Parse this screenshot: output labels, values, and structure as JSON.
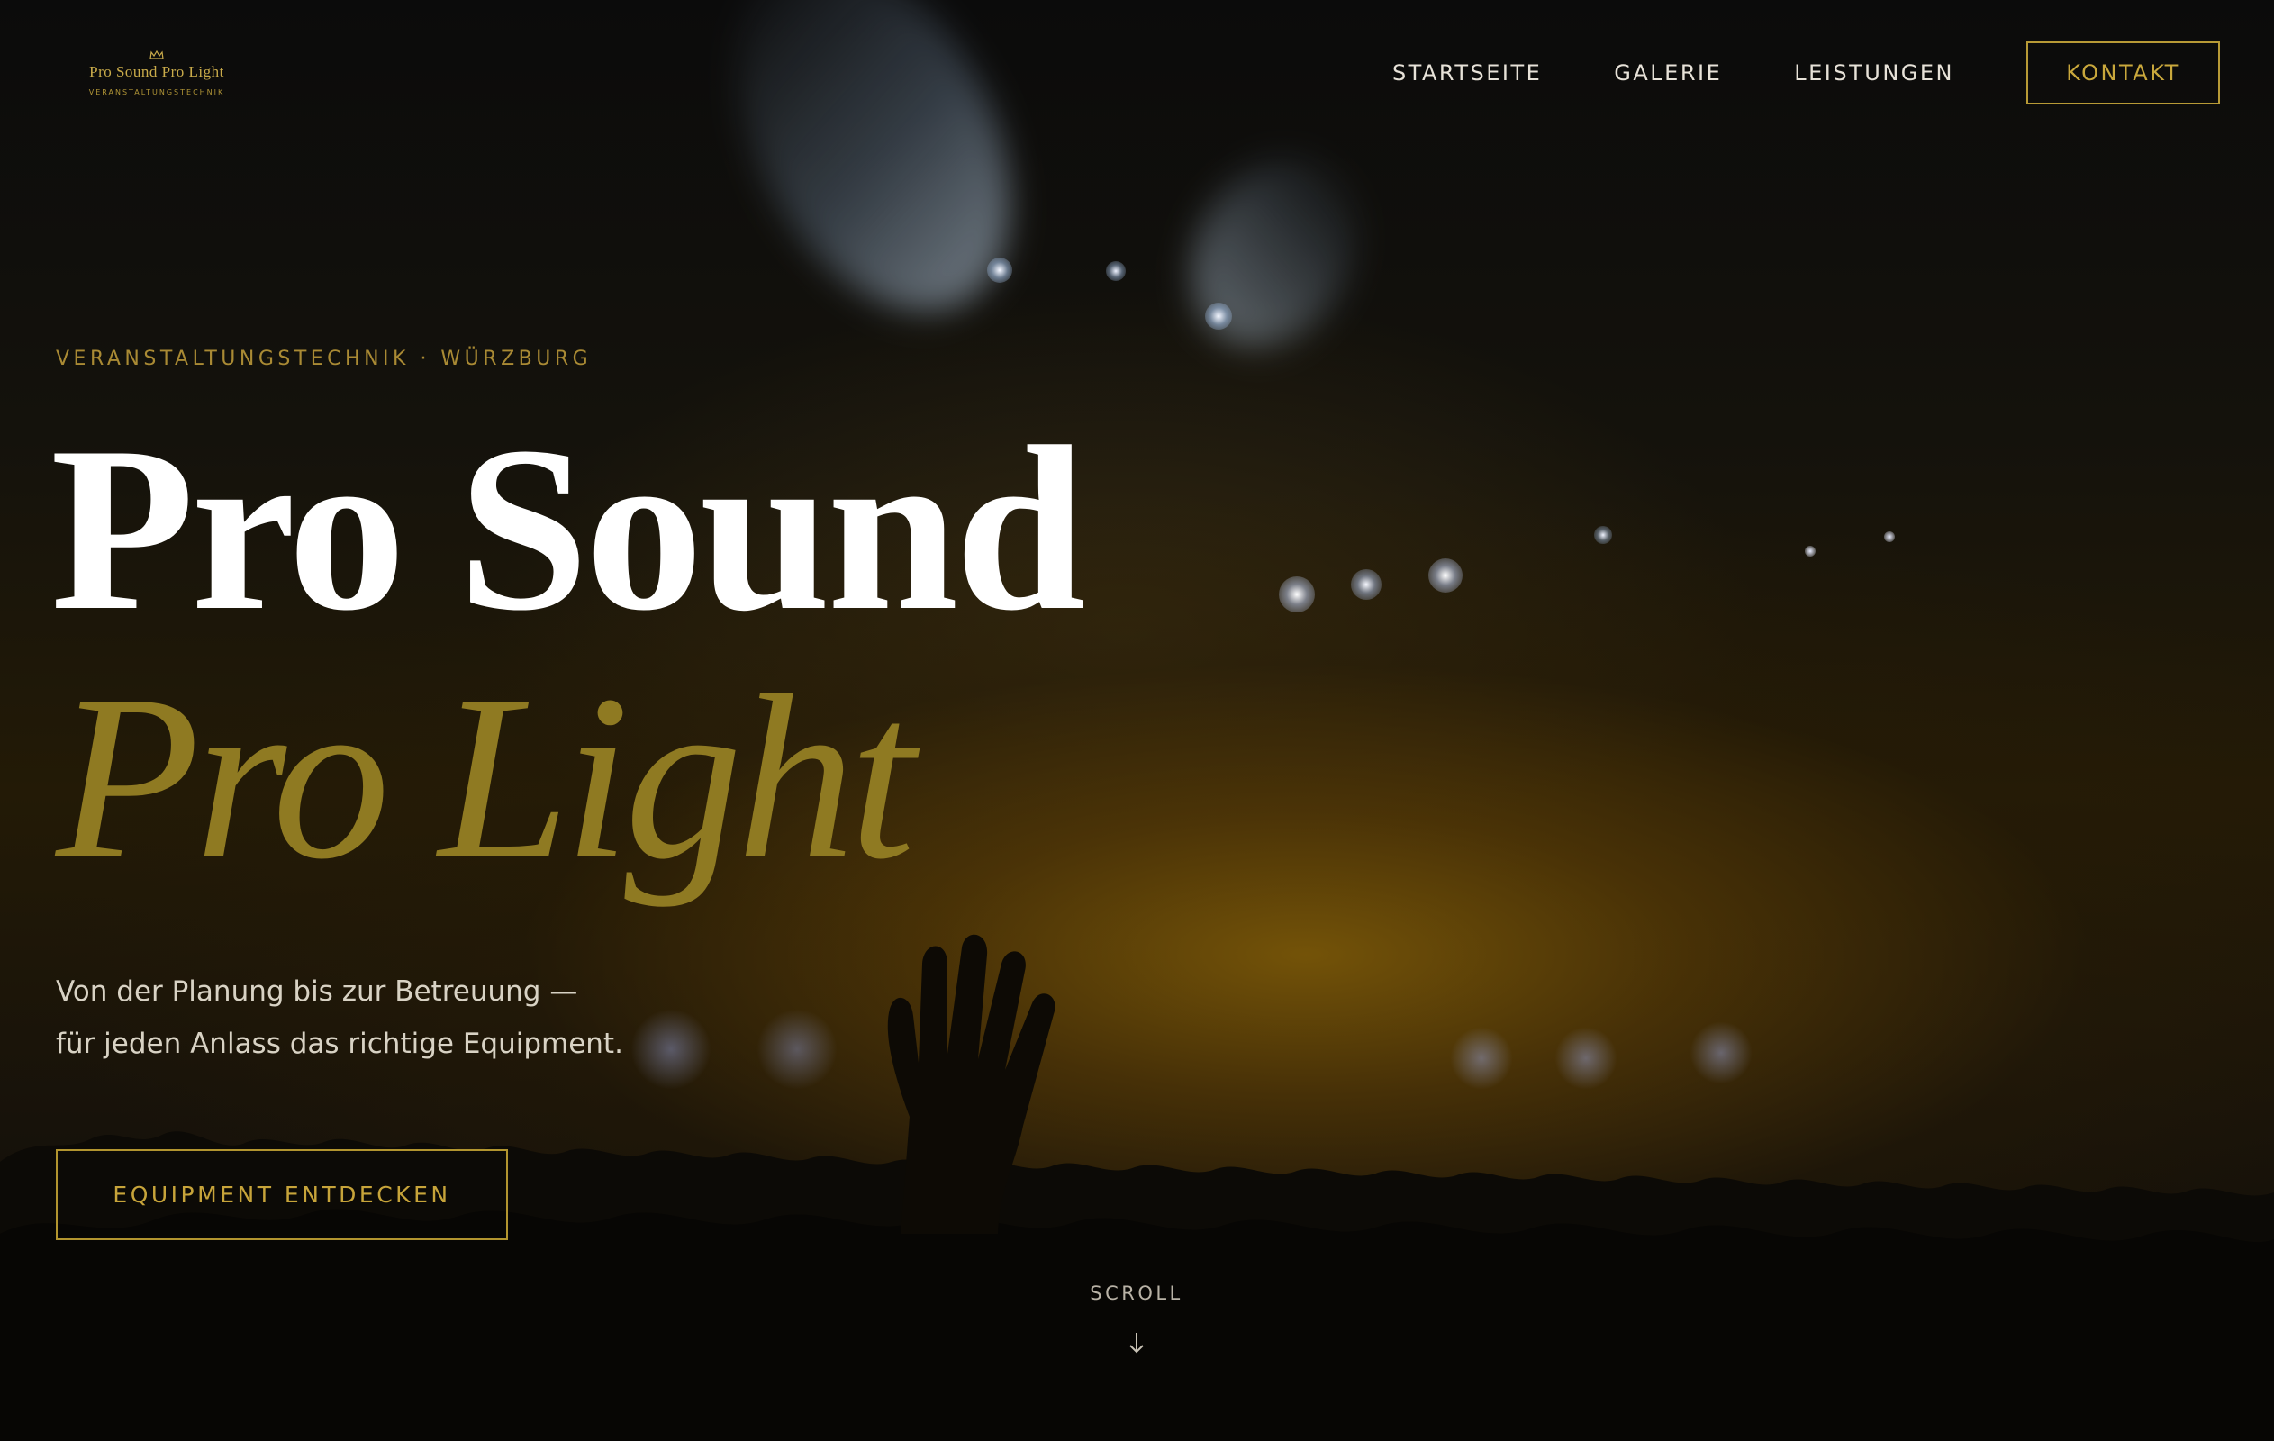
{
  "brand": {
    "name": "Pro Sound Pro Light",
    "tagline": "VERANSTALTUNGSTECHNIK"
  },
  "nav": {
    "items": [
      {
        "label": "STARTSEITE"
      },
      {
        "label": "GALERIE"
      },
      {
        "label": "LEISTUNGEN"
      }
    ],
    "cta_label": "KONTAKT"
  },
  "hero": {
    "eyebrow": "VERANSTALTUNGSTECHNIK · WÜRZBURG",
    "title_line1": "Pro Sound",
    "title_line2": "Pro Light",
    "lead_line1": "Von der Planung bis zur Betreuung —",
    "lead_line2": "für jeden Anlass das richtige Equipment.",
    "cta_label": "EQUIPMENT ENTDECKEN",
    "scroll_label": "SCROLL"
  },
  "icons": {
    "logo_mark": "crown-icon",
    "scroll": "arrow-down-icon"
  },
  "colors": {
    "accent_gold": "#b79a36",
    "title_gold": "#8f7a22",
    "text_light": "#e7e2d8",
    "background": "#0a0906"
  }
}
